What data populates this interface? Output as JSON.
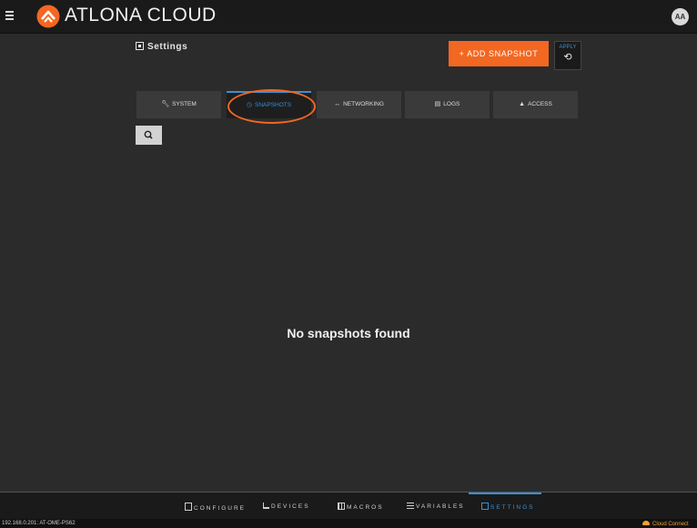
{
  "header": {
    "brand": "ATLONA CLOUD",
    "avatar_initials": "AA"
  },
  "page": {
    "title": "Settings"
  },
  "actions": {
    "add_snapshot": "+ ADD SNAPSHOT",
    "apply_label": "APPLY"
  },
  "tabs": [
    {
      "label": "SYSTEM",
      "icon": "wrench-icon"
    },
    {
      "label": "SNAPSHOTS",
      "icon": "clock-icon",
      "active": true
    },
    {
      "label": "NETWORKING",
      "icon": "arrows-icon"
    },
    {
      "label": "LOGS",
      "icon": "document-icon"
    },
    {
      "label": "ACCESS",
      "icon": "user-icon"
    }
  ],
  "empty_message": "No snapshots found",
  "bottom_nav": [
    {
      "label": "CONFIGURE",
      "icon": "configure-icon"
    },
    {
      "label": "DEVICES",
      "icon": "devices-icon"
    },
    {
      "label": "MACROS",
      "icon": "macros-icon"
    },
    {
      "label": "VARIABLES",
      "icon": "variables-icon"
    },
    {
      "label": "SETTINGS",
      "icon": "settings-icon",
      "active": true
    }
  ],
  "status": {
    "device": "192.168.0.201: AT-OME-PS62",
    "connection": "Cloud Connect"
  },
  "colors": {
    "accent_orange": "#f26722",
    "accent_blue": "#3a8fd6",
    "background": "#2b2b2b"
  }
}
